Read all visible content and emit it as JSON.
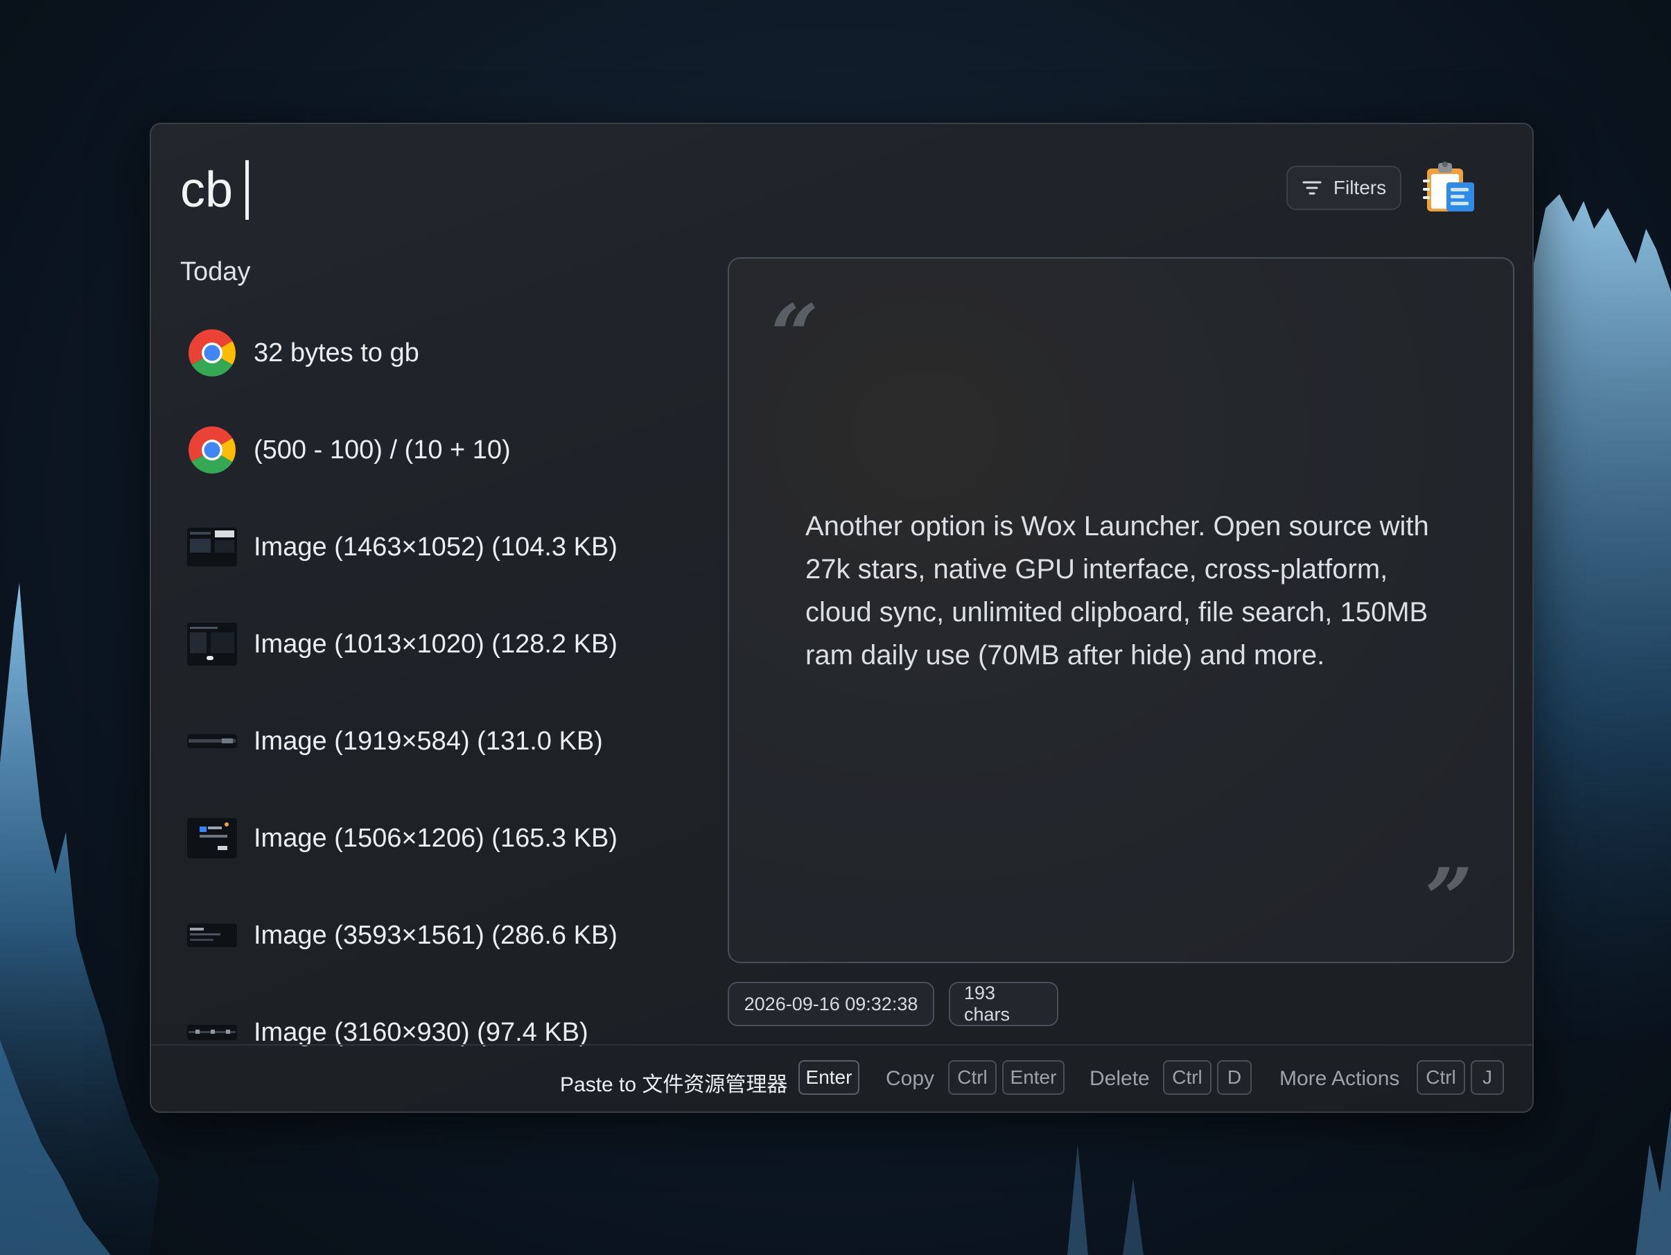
{
  "search": {
    "query": "cb"
  },
  "header": {
    "filters_label": "Filters"
  },
  "results": {
    "section_label": "Today",
    "items": [
      {
        "label": "32 bytes to gb",
        "icon": "chrome-icon"
      },
      {
        "label": "(500 - 100) / (10 + 10)",
        "icon": "chrome-icon"
      },
      {
        "label": "Image (1463×1052) (104.3 KB)",
        "icon": "image-thumbnail"
      },
      {
        "label": "Image (1013×1020) (128.2 KB)",
        "icon": "image-thumbnail"
      },
      {
        "label": "Image (1919×584) (131.0 KB)",
        "icon": "image-thumbnail"
      },
      {
        "label": "Image (1506×1206) (165.3 KB)",
        "icon": "image-thumbnail"
      },
      {
        "label": "Image (3593×1561) (286.6 KB)",
        "icon": "image-thumbnail"
      },
      {
        "label": "Image (3160×930) (97.4 KB)",
        "icon": "image-thumbnail"
      }
    ]
  },
  "preview": {
    "text": "Another option is Wox Launcher. Open source with 27k stars, native GPU interface, cross-platform, cloud sync, unlimited clipboard, file search,  150MB ram daily use (70MB after hide) and more.",
    "timestamp": "2026-09-16 09:32:38",
    "char_count": "193 chars"
  },
  "actions": {
    "paste": {
      "label": "Paste to 文件资源管理器",
      "keys": [
        "Enter"
      ]
    },
    "copy": {
      "label": "Copy",
      "keys": [
        "Ctrl",
        "Enter"
      ]
    },
    "delete": {
      "label": "Delete",
      "keys": [
        "Ctrl",
        "D"
      ]
    },
    "more": {
      "label": "More Actions",
      "keys": [
        "Ctrl",
        "J"
      ]
    }
  },
  "colors": {
    "accent_chrome_red": "#ea4335",
    "accent_chrome_yellow": "#fbbc05",
    "accent_chrome_green": "#34a853",
    "accent_chrome_blue": "#4285f4",
    "wallpaper_glow": "#5a9ed6"
  }
}
